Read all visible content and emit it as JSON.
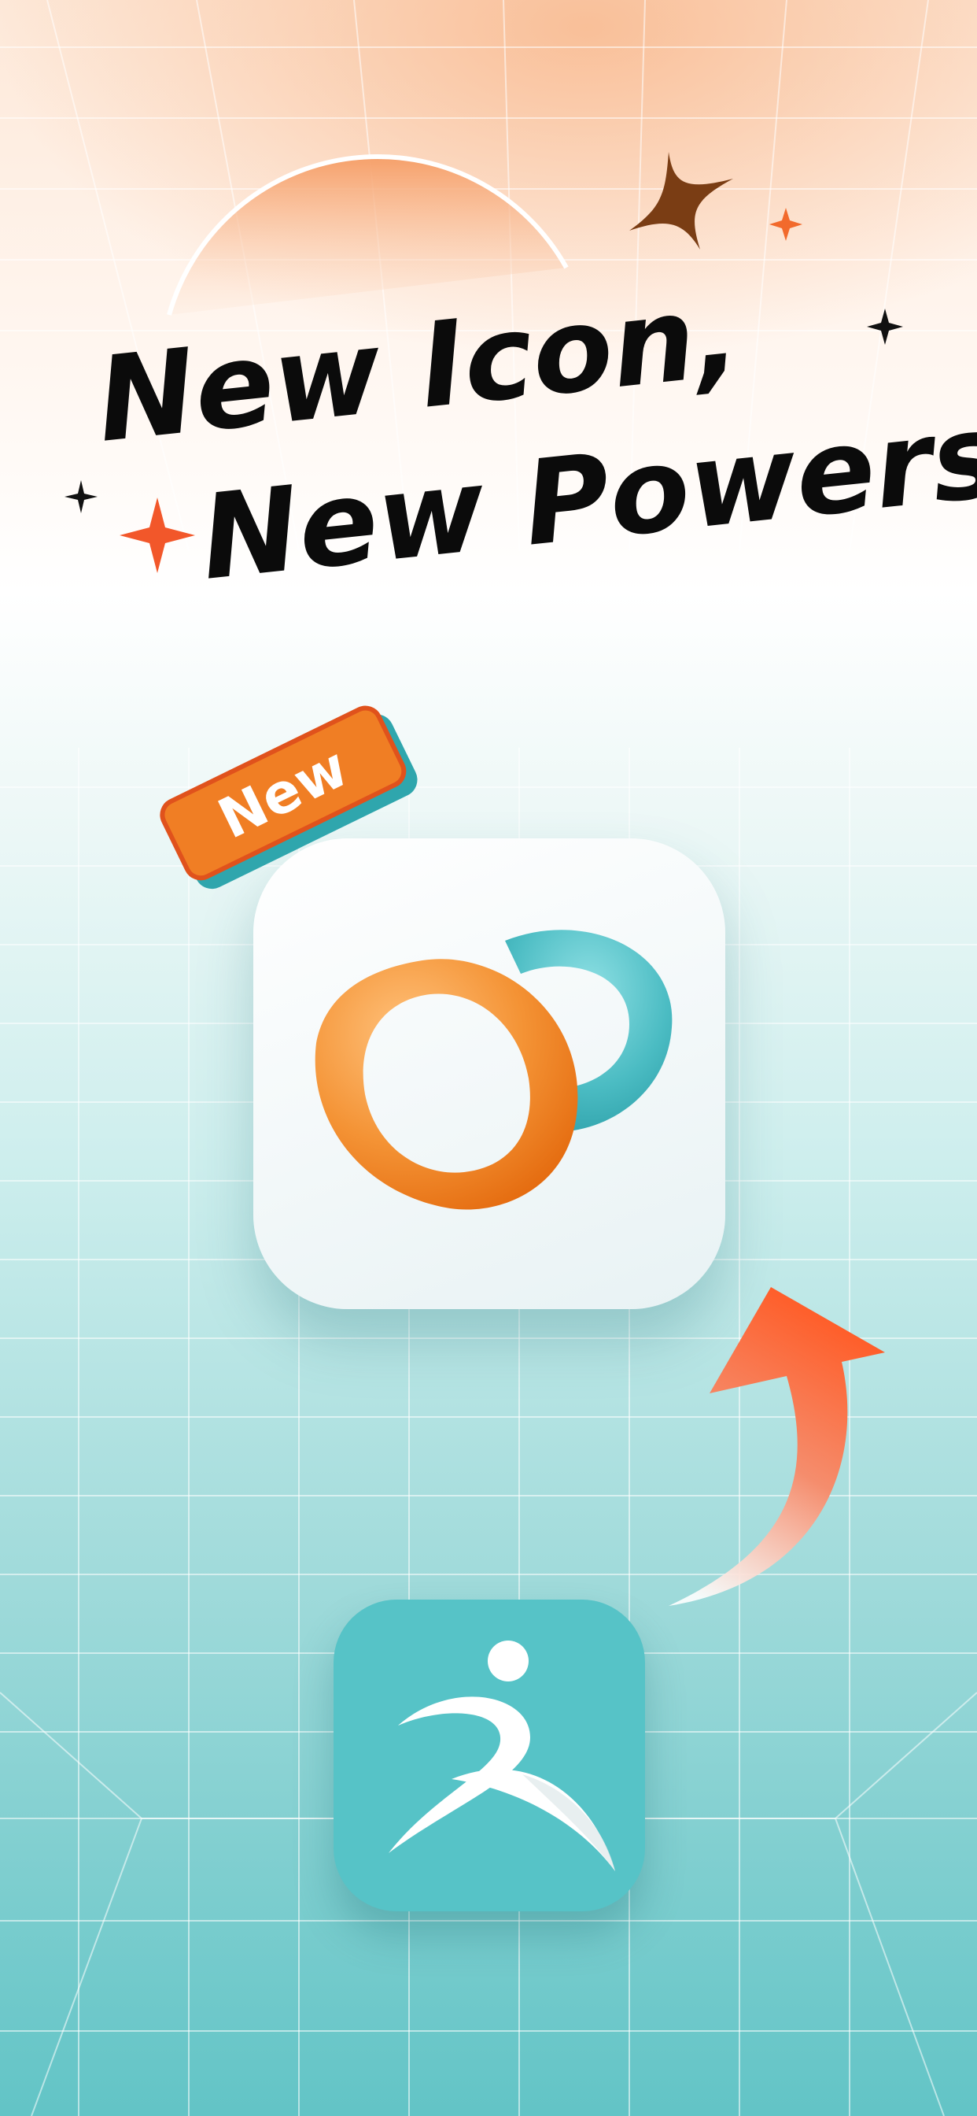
{
  "headline": {
    "line1": "New Icon,",
    "line2": "New Powers!"
  },
  "badge": {
    "label": "New"
  },
  "icons": {
    "new_icon": "two-rings-app-icon",
    "old_icon": "dancing-figure-app-icon",
    "arrow": "curved-up-arrow-icon"
  },
  "colors": {
    "orange": "#f07e24",
    "teal": "#4bbcc3",
    "arrow_red": "#ff5a24",
    "text": "#0b0b0b"
  }
}
